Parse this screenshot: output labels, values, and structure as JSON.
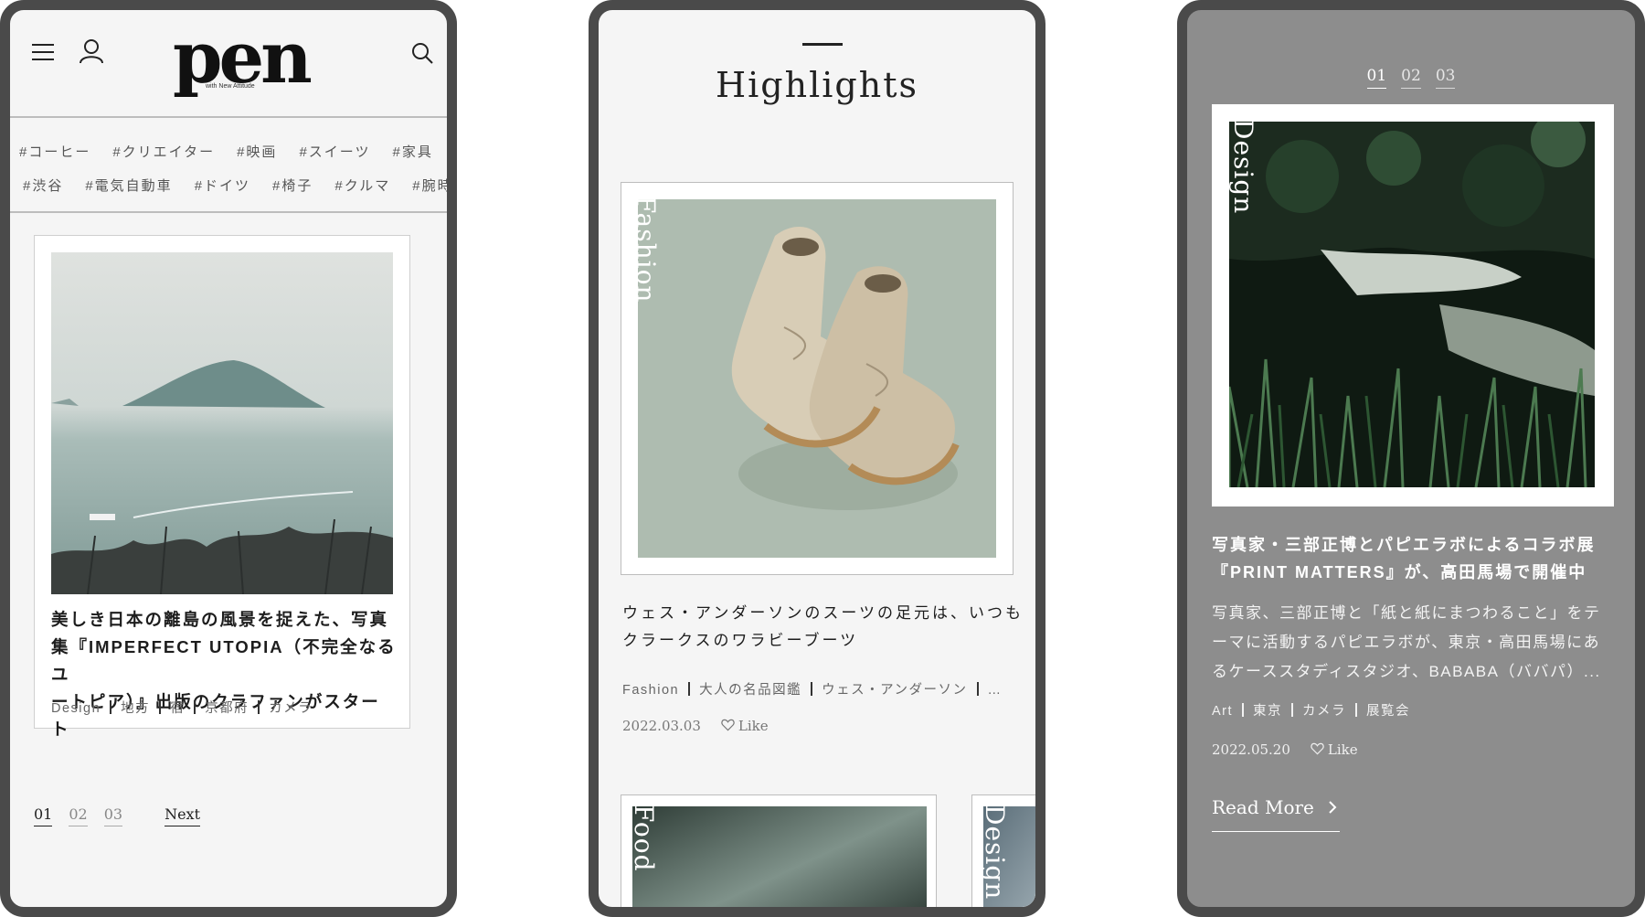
{
  "screen1": {
    "logo": {
      "text": "pen",
      "tagline": "with New Attitude"
    },
    "tags_row1": [
      "#コーヒー",
      "#クリエイター",
      "#映画",
      "#スイーツ",
      "#家具"
    ],
    "tags_row2": [
      "#渋谷",
      "#電気自動車",
      "#ドイツ",
      "#椅子",
      "#クルマ",
      "#腕時"
    ],
    "article": {
      "title_lines": [
        "美しき日本の離島の風景を捉えた、写真",
        "集『IMPERFECT UTOPIA（不完全なるユ",
        "ートピア）』出版のクラファンがスタート"
      ],
      "tags": [
        "Design",
        "地方",
        "宿",
        "京都府",
        "カメラ"
      ]
    },
    "pager": {
      "pages": [
        "01",
        "02",
        "03"
      ],
      "active": "01",
      "next_label": "Next"
    }
  },
  "screen2": {
    "section_title": "Highlights",
    "main_card": {
      "category": "Fashion",
      "title_lines": [
        "ウェス・アンダーソンのスーツの足元は、いつも",
        "クラークスのワラビーブーツ"
      ],
      "tags": [
        "Fashion",
        "大人の名品図鑑",
        "ウェス・アンダーソン",
        "…"
      ],
      "date": "2022.03.03",
      "like_label": "Like"
    },
    "mini_cards": [
      {
        "category": "Food"
      },
      {
        "category": "Design"
      }
    ]
  },
  "screen3": {
    "pager": {
      "pages": [
        "01",
        "02",
        "03"
      ],
      "active": "01"
    },
    "card": {
      "category": "Design",
      "title_lines": [
        "写真家・三部正博とパピエラボによるコラボ展",
        "『PRINT MATTERS』が、高田馬場で開催中"
      ],
      "body_lines": [
        "写真家、三部正博と「紙と紙にまつわること」をテ",
        "ーマに活動するパピエラボが、東京・高田馬場にあ",
        "るケーススタディスタジオ、BABABA（ババパ）..."
      ],
      "tags": [
        "Art",
        "東京",
        "カメラ",
        "展覧会"
      ],
      "date": "2022.05.20",
      "like_label": "Like",
      "read_more": "Read More"
    }
  },
  "colors": {
    "frame": "#4a4a4a",
    "screen_bg": "#f5f5f5",
    "dark_screen_bg": "#8d8d8d"
  }
}
